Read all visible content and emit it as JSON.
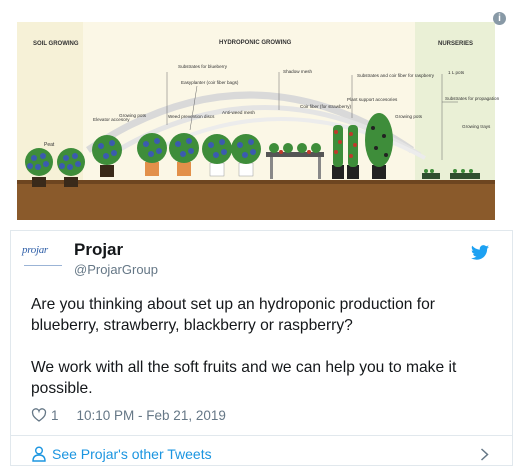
{
  "illustration": {
    "sections": [
      "SOIL GROWING",
      "HYDROPONIC GROWING",
      "NURSERIES"
    ],
    "labels": {
      "peat": "Peat",
      "elevator": "Elevator accesory",
      "growing_pots": "Growing pots",
      "substrates_blueberry": "Substrates for blueberry",
      "easyplanter": "Easyplanter (coir fiber bags)",
      "weed_discs": "Weed prevention discs",
      "anti_weed": "Anti-weed mesh",
      "shadow_mesh": "Shadow mesh",
      "coir_strawberry": "Coir fiber (for strawberry)",
      "plant_support": "Plant support accesories",
      "substrates_raspberry": "Substrates and coir fiber for raspberry",
      "growing_pots_2": "Growing pots",
      "one_l_pots": "1 L pots",
      "substrates_propagation": "Substrates for propagation",
      "growing_trays": "Growing trays"
    },
    "colors": {
      "soil": "#8a5a2b",
      "soil_zone": "#f6f1d7",
      "hydro_zone": "#fbf7e6",
      "nursery_zone": "#eaf0d6",
      "blueberry": "#3b5bb0",
      "leaf": "#3e8d3a",
      "berry_red": "#c0392b"
    }
  },
  "tweet": {
    "display_name": "Projar",
    "handle": "@ProjarGroup",
    "avatar_text": "projar",
    "paragraph1": "Are you thinking about set up an hydroponic production for blueberry, strawberry, blackberry or raspberry?",
    "paragraph2": "We work with all the soft fruits and we can help you to make it possible.",
    "likes": "1",
    "timestamp": "10:10 PM - Feb 21, 2019",
    "other_tweets_label": "See Projar's other Tweets",
    "icons": {
      "info": "info-icon",
      "brand": "twitter-bird-icon",
      "like": "heart-icon",
      "profile": "person-icon",
      "more": "chevron-right-icon"
    },
    "colors": {
      "link": "#1b95e0",
      "muted": "#657786",
      "text": "#14171a",
      "border": "#e1e8ed"
    }
  }
}
